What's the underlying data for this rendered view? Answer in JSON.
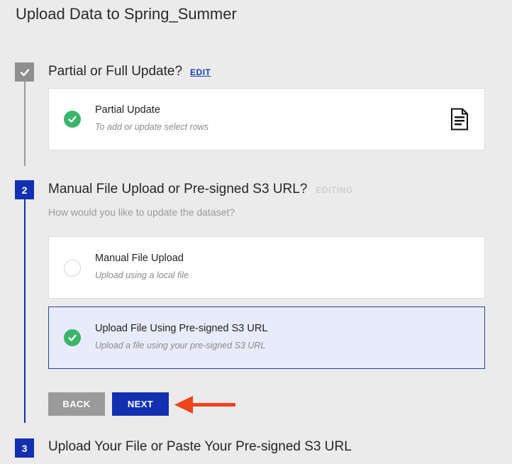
{
  "page": {
    "title": "Upload Data to Spring_Summer"
  },
  "steps": [
    {
      "badge_icon": "check-icon",
      "heading": "Partial or Full Update?",
      "action_label": "EDIT",
      "selected_option": {
        "title": "Partial Update",
        "description": "To add or update select rows",
        "status_icon": "green-check-icon",
        "type_icon": "document-icon"
      }
    },
    {
      "number": "2",
      "heading": "Manual File Upload or Pre-signed S3 URL?",
      "status_label": "EDITING",
      "question": "How would you like to update the dataset?",
      "options": [
        {
          "title": "Manual File Upload",
          "description": "Upload using a local file",
          "selected": false
        },
        {
          "title": "Upload File Using Pre-signed S3 URL",
          "description": "Upload a file using your pre-signed S3 URL",
          "selected": true
        }
      ],
      "back_label": "BACK",
      "next_label": "NEXT"
    },
    {
      "number": "3",
      "heading": "Upload Your File or Paste Your Pre-signed S3 URL"
    }
  ],
  "colors": {
    "primary": "#1230b0",
    "success": "#3bb56a",
    "muted_button": "#9a9a9a",
    "annotation_arrow": "#f0441c",
    "selected_bg": "#e8ecfa"
  }
}
